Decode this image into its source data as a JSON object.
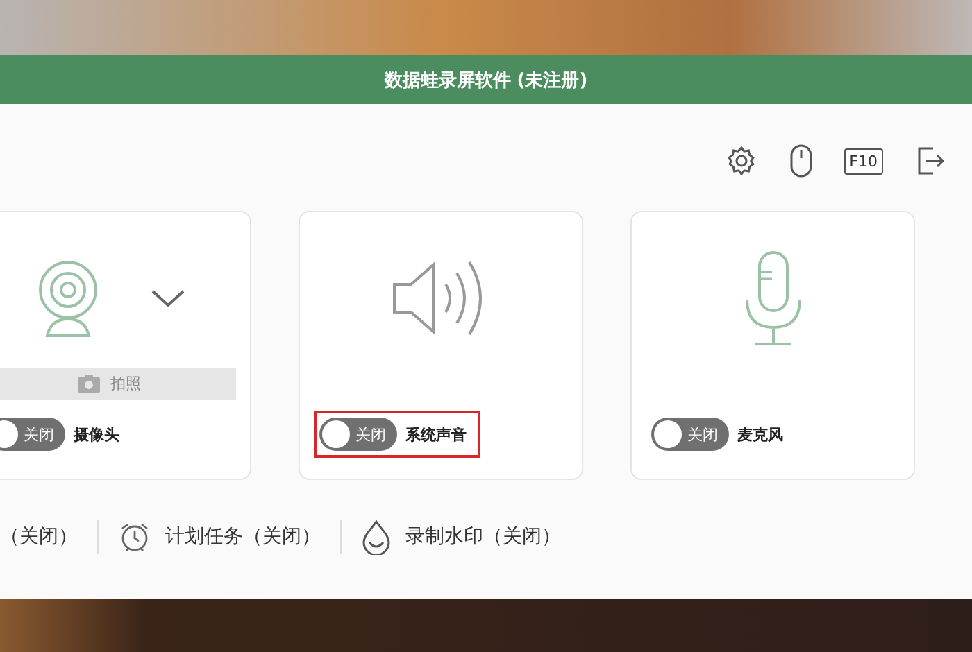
{
  "window": {
    "title": "数据蛙录屏软件 (未注册)"
  },
  "toolbar": {
    "hotkey_label": "F10"
  },
  "sources": [
    {
      "kind": "camera",
      "label": "摄像头",
      "toggle": "关闭",
      "on": false,
      "highlighted": false,
      "capture_button": {
        "label": "拍照",
        "disabled": true
      }
    },
    {
      "kind": "speaker",
      "label": "系统声音",
      "toggle": "关闭",
      "on": false,
      "highlighted": true
    },
    {
      "kind": "microphone",
      "label": "麦克风",
      "toggle": "关闭",
      "on": false,
      "highlighted": false
    }
  ],
  "status_items": [
    {
      "kind": "timer",
      "label": "（关闭）"
    },
    {
      "kind": "schedule",
      "label": "计划任务（关闭）"
    },
    {
      "kind": "watermark",
      "label": "录制水印（关闭）"
    }
  ]
}
